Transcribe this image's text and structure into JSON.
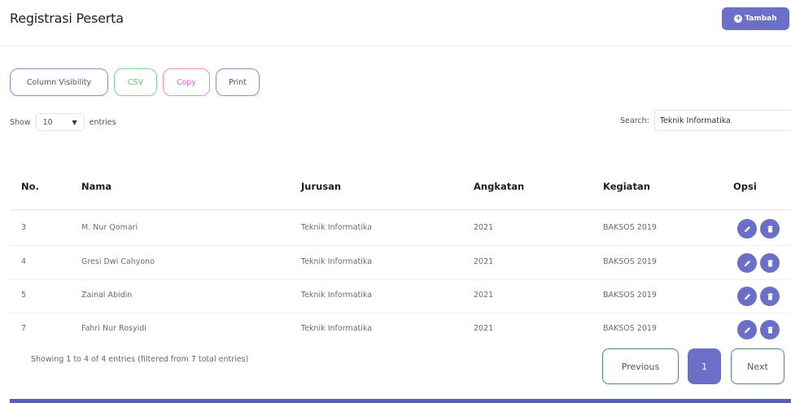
{
  "header": {
    "title": "Registrasi Peserta",
    "add_label": "Tambah"
  },
  "toolbar": {
    "column_visibility": "Column Visibility",
    "csv": "CSV",
    "copy": "Copy",
    "print": "Print"
  },
  "length": {
    "show_label": "Show",
    "value": "10",
    "entries_label": "entries"
  },
  "search": {
    "label": "Search:",
    "value": "Teknik Informatika"
  },
  "table": {
    "columns": [
      "No.",
      "Nama",
      "Jurusan",
      "Angkatan",
      "Kegiatan",
      "Opsi"
    ],
    "rows": [
      {
        "no": "3",
        "nama": "M. Nur Qomari",
        "jurusan": "Teknik Informatika",
        "angkatan": "2021",
        "kegiatan": "BAKSOS 2019"
      },
      {
        "no": "4",
        "nama": "Gresi Dwi Cahyono",
        "jurusan": "Teknik Informatika",
        "angkatan": "2021",
        "kegiatan": "BAKSOS 2019"
      },
      {
        "no": "5",
        "nama": "Zainal Abidin",
        "jurusan": "Teknik Informatika",
        "angkatan": "2021",
        "kegiatan": "BAKSOS 2019"
      },
      {
        "no": "7",
        "nama": "Fahri Nur Rosyidi",
        "jurusan": "Teknik Informatika",
        "angkatan": "2021",
        "kegiatan": "BAKSOS 2019"
      }
    ]
  },
  "footer": {
    "info": "Showing 1 to 4 of 4 entries (filtered from 7 total entries)"
  },
  "pagination": {
    "previous": "Previous",
    "current": "1",
    "next": "Next"
  },
  "colors": {
    "accent": "#6c6fc8",
    "csv": "#6cc07b",
    "copy": "#d36cc2",
    "pager_border": "#4f8f63"
  },
  "icons": {
    "add": "plus-circle-icon",
    "length_dropdown": "chevron-down-icon",
    "edit": "pencil-icon",
    "delete": "trash-icon"
  }
}
